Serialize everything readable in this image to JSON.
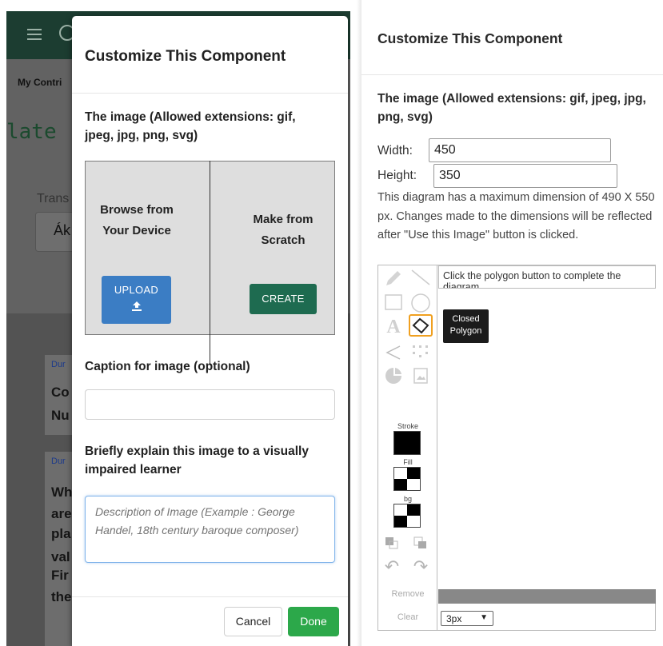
{
  "background_page": {
    "breadcrumb": "My Contri",
    "title": "late",
    "translate_label": "Trans",
    "select_value": "Ák",
    "cards": [
      {
        "line1": "Dur",
        "line2": "Co"
      },
      {
        "line1": "",
        "line2": "Nu"
      },
      {
        "line1": "Dur",
        "line2": "Wh"
      },
      {
        "line1": "",
        "line2": "are"
      },
      {
        "line1": "",
        "line2": "pla"
      },
      {
        "line1": "",
        "line2": "val"
      },
      {
        "line1": "",
        "line2": "Fir"
      },
      {
        "line1": "",
        "line2": "the"
      }
    ]
  },
  "left_modal": {
    "title": "Customize This Component",
    "image_label": "The image (Allowed extensions: gif, jpeg, jpg, png, svg)",
    "browse_label": "Browse from Your Device",
    "scratch_label": "Make from Scratch",
    "upload_button": "UPLOAD",
    "create_button": "CREATE",
    "caption_label": "Caption for image (optional)",
    "caption_value": "",
    "explain_label": "Briefly explain this image to a visually impaired learner",
    "description_placeholder": "Description of Image (Example : George Handel, 18th century baroque composer)",
    "cancel_button": "Cancel",
    "done_button": "Done",
    "colors": {
      "upload": "#3b7dc4",
      "create": "#1e6b50",
      "done": "#2ca84a"
    }
  },
  "right_panel": {
    "title": "Customize This Component",
    "image_label": "The image (Allowed extensions: gif, jpeg, jpg, png, svg)",
    "width_label": "Width:",
    "width_value": "450",
    "height_label": "Height:",
    "height_value": "350",
    "dimension_note": "This diagram has a maximum dimension of 490 X 550 px. Changes made to the dimensions will be reflected after \"Use this Image\" button is clicked.",
    "editor": {
      "help_text": "Click the polygon button to complete the diagram.",
      "tooltip": "Closed Polygon",
      "stroke_label": "Stroke",
      "fill_label": "Fill",
      "bg_label": "bg",
      "remove_label": "Remove",
      "clear_label": "Clear",
      "stroke_width": "3px",
      "tools": [
        "pencil-icon",
        "line-icon",
        "rectangle-icon",
        "circle-icon",
        "text-icon",
        "closed-polygon-icon",
        "open-polygon-icon",
        "bezier-icon",
        "pie-icon",
        "image-icon"
      ]
    }
  }
}
